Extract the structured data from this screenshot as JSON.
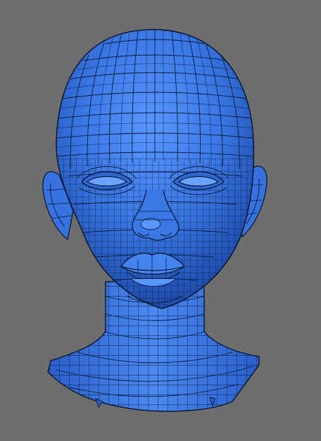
{
  "viewport": {
    "background_color": "#6e6e6e"
  },
  "model": {
    "subject": "head-mesh",
    "display_mode": "shaded-wireframe",
    "surface_color": "#3a78e6",
    "surface_highlight_color": "#5a96ff",
    "surface_shadow_color": "#1f4fb0",
    "wire_color": "#0d1a33"
  }
}
